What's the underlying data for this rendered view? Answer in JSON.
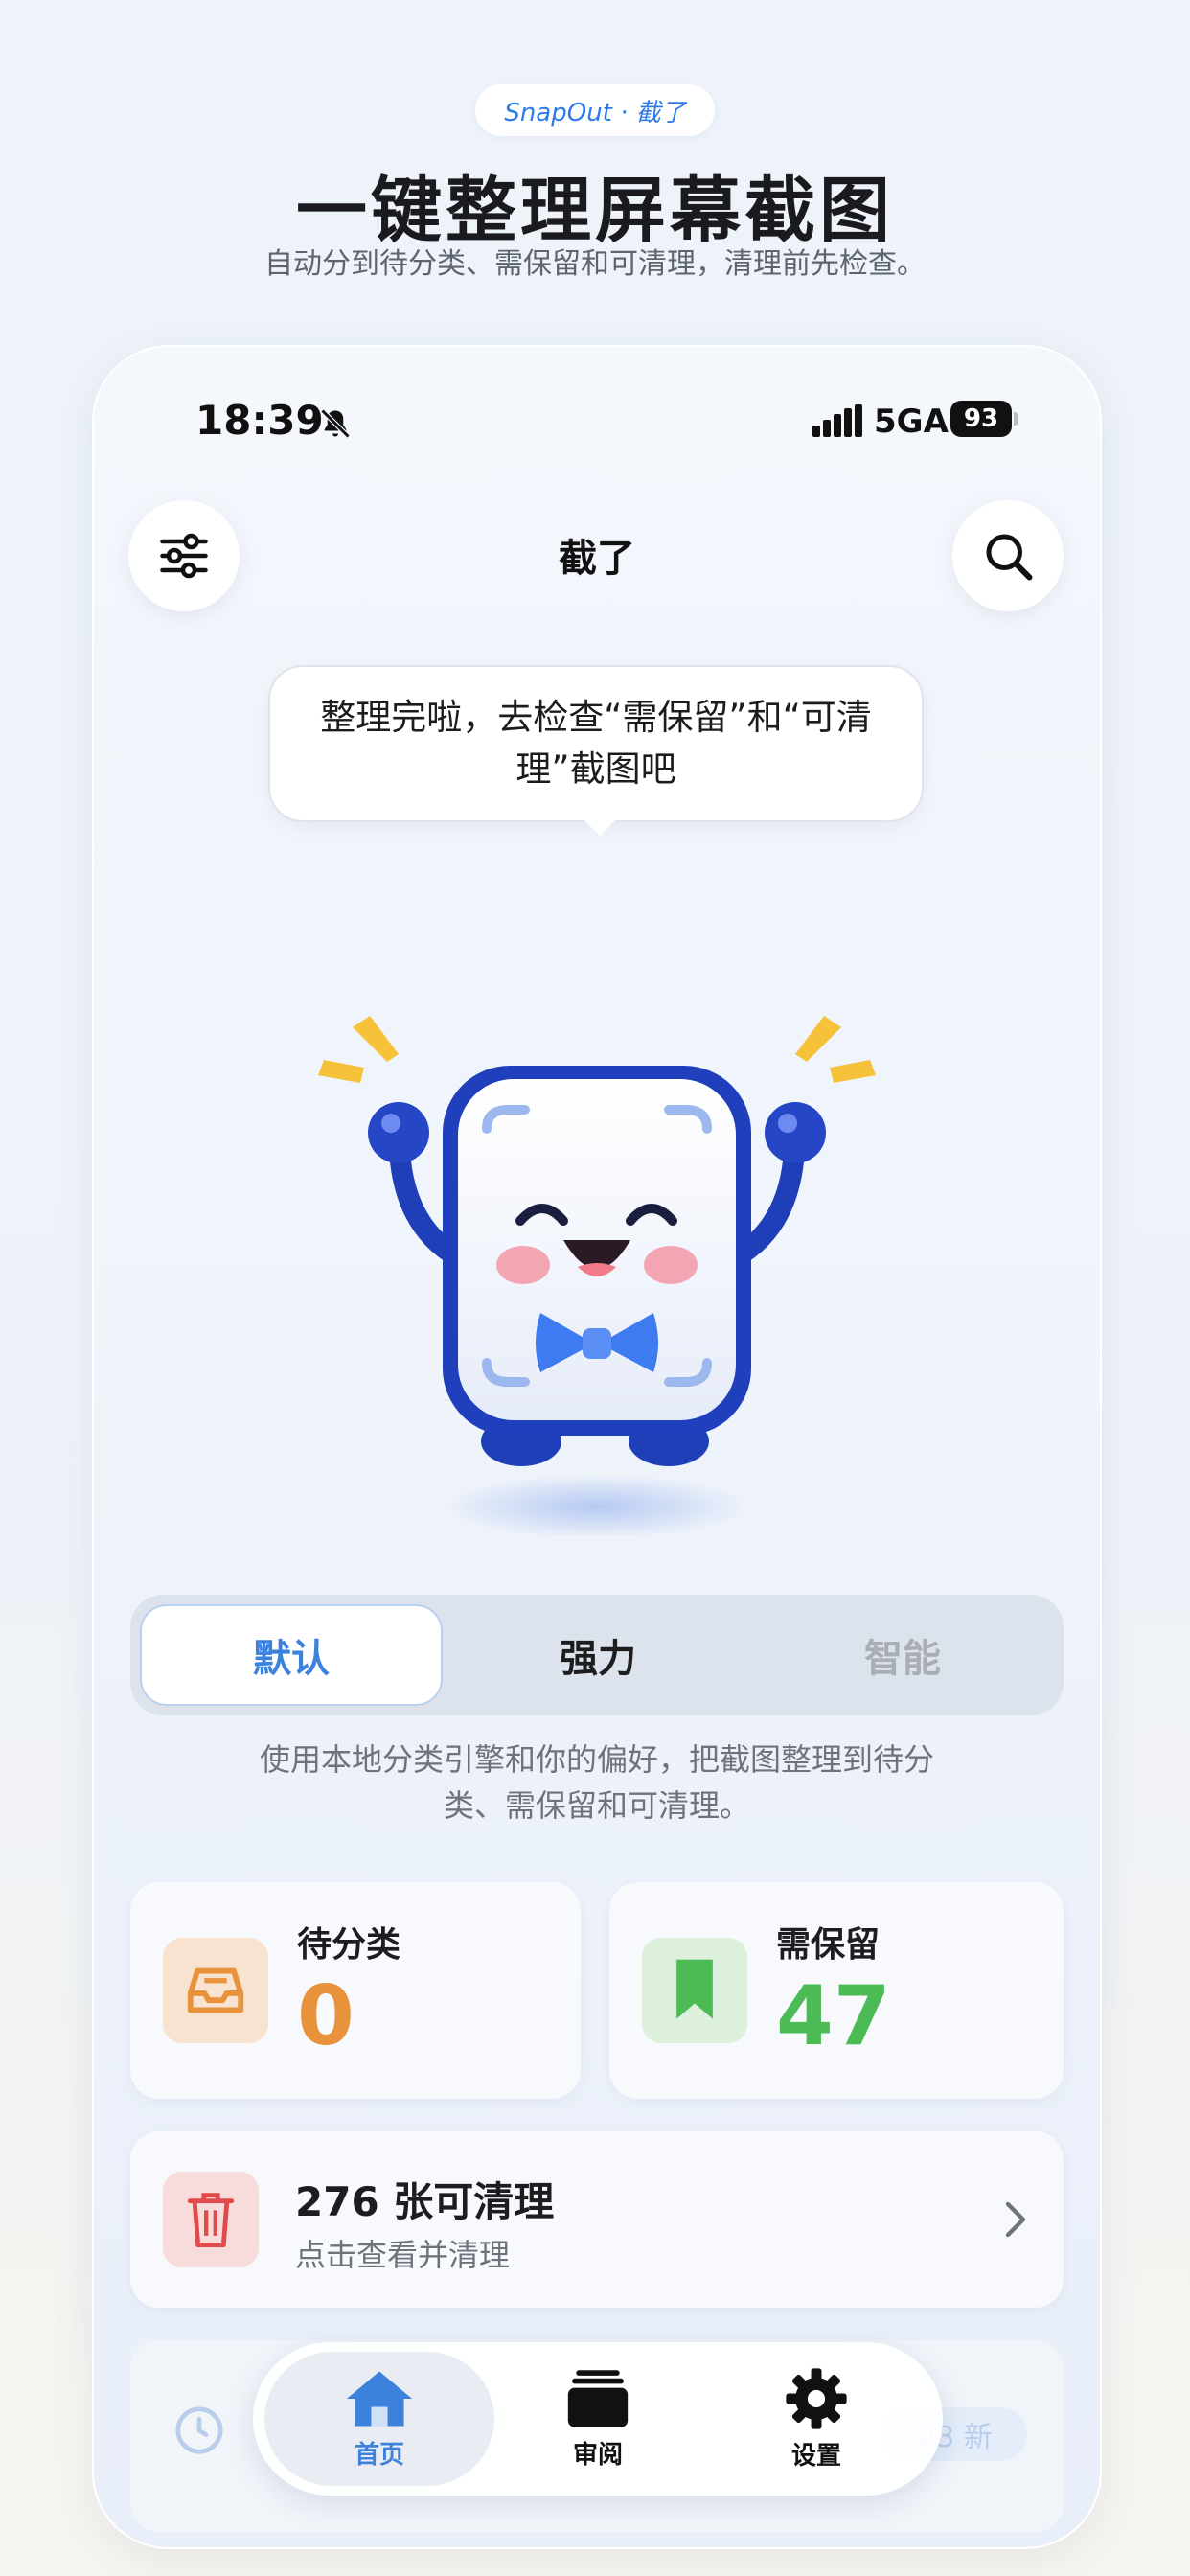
{
  "promo": {
    "tag": "SnapOut · 截了",
    "headline": "一键整理屏幕截图",
    "subline": "自动分到待分类、需保留和可清理，清理前先检查。"
  },
  "status_bar": {
    "time": "18:39",
    "network": "5GA",
    "battery": "93",
    "icons": [
      "bell-muted-icon",
      "signal-icon"
    ]
  },
  "header": {
    "title": "截了",
    "left_icon": "sliders-icon",
    "right_icon": "search-icon"
  },
  "bubble": {
    "text": "整理完啦，去检查“需保留”和“可清理”截图吧"
  },
  "modes": {
    "options": [
      "默认",
      "强力",
      "智能"
    ],
    "selected": "默认",
    "description": "使用本地分类引擎和你的偏好，把截图整理到待分类、需保留和可清理。"
  },
  "stats": {
    "pending": {
      "label": "待分类",
      "value": "0",
      "icon": "inbox-icon",
      "color": "#e8923c"
    },
    "keep": {
      "label": "需保留",
      "value": "47",
      "icon": "bookmark-icon",
      "color": "#4cba55"
    }
  },
  "cleanable": {
    "title": "276 张可清理",
    "subtitle": "点击查看并清理",
    "icon": "trash-icon",
    "color": "#e04a4a"
  },
  "history_card": {
    "icon": "clock-icon",
    "badge": "23 新"
  },
  "tabbar": {
    "items": [
      {
        "label": "首页",
        "icon": "home-icon",
        "active": true
      },
      {
        "label": "审阅",
        "icon": "cards-stack-icon",
        "active": false
      },
      {
        "label": "设置",
        "icon": "gear-icon",
        "active": false
      }
    ]
  }
}
